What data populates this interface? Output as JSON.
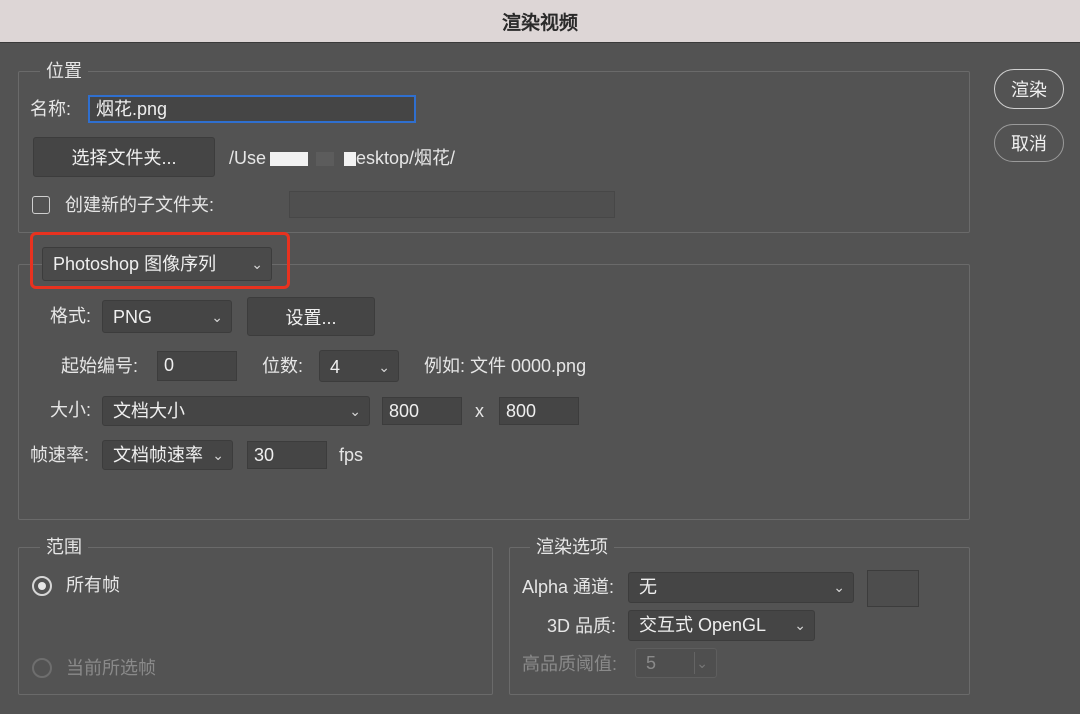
{
  "window": {
    "title": "渲染视频"
  },
  "actions": {
    "render": "渲染",
    "cancel": "取消"
  },
  "location": {
    "legend": "位置",
    "name_label": "名称:",
    "name_value": "烟花.png",
    "choose_folder": "选择文件夹...",
    "path_prefix": "/Use",
    "path_suffix": "esktop/烟花/",
    "subfolder_label": "创建新的子文件夹:",
    "subfolder_value": ""
  },
  "export": {
    "mode": "Photoshop 图像序列",
    "format_label": "格式:",
    "format_value": "PNG",
    "settings_button": "设置...",
    "start_label": "起始编号:",
    "start_value": "0",
    "digits_label": "位数:",
    "digits_value": "4",
    "example": "例如: 文件 0000.png",
    "size_label": "大小:",
    "size_value": "文档大小",
    "width": "800",
    "x": "x",
    "height": "800",
    "fps_label": "帧速率:",
    "fps_mode": "文档帧速率",
    "fps_value": "30",
    "fps_unit": "fps"
  },
  "range": {
    "legend": "范围",
    "all_frames": "所有帧",
    "current_frames": "当前所选帧"
  },
  "render_options": {
    "legend": "渲染选项",
    "alpha_label": "Alpha 通道:",
    "alpha_value": "无",
    "quality_label": "3D 品质:",
    "quality_value": "交互式 OpenGL",
    "threshold_label": "高品质阈值:",
    "threshold_value": "5"
  },
  "colors": {
    "highlight": "#e8321f",
    "focus": "#2f6fcf"
  }
}
